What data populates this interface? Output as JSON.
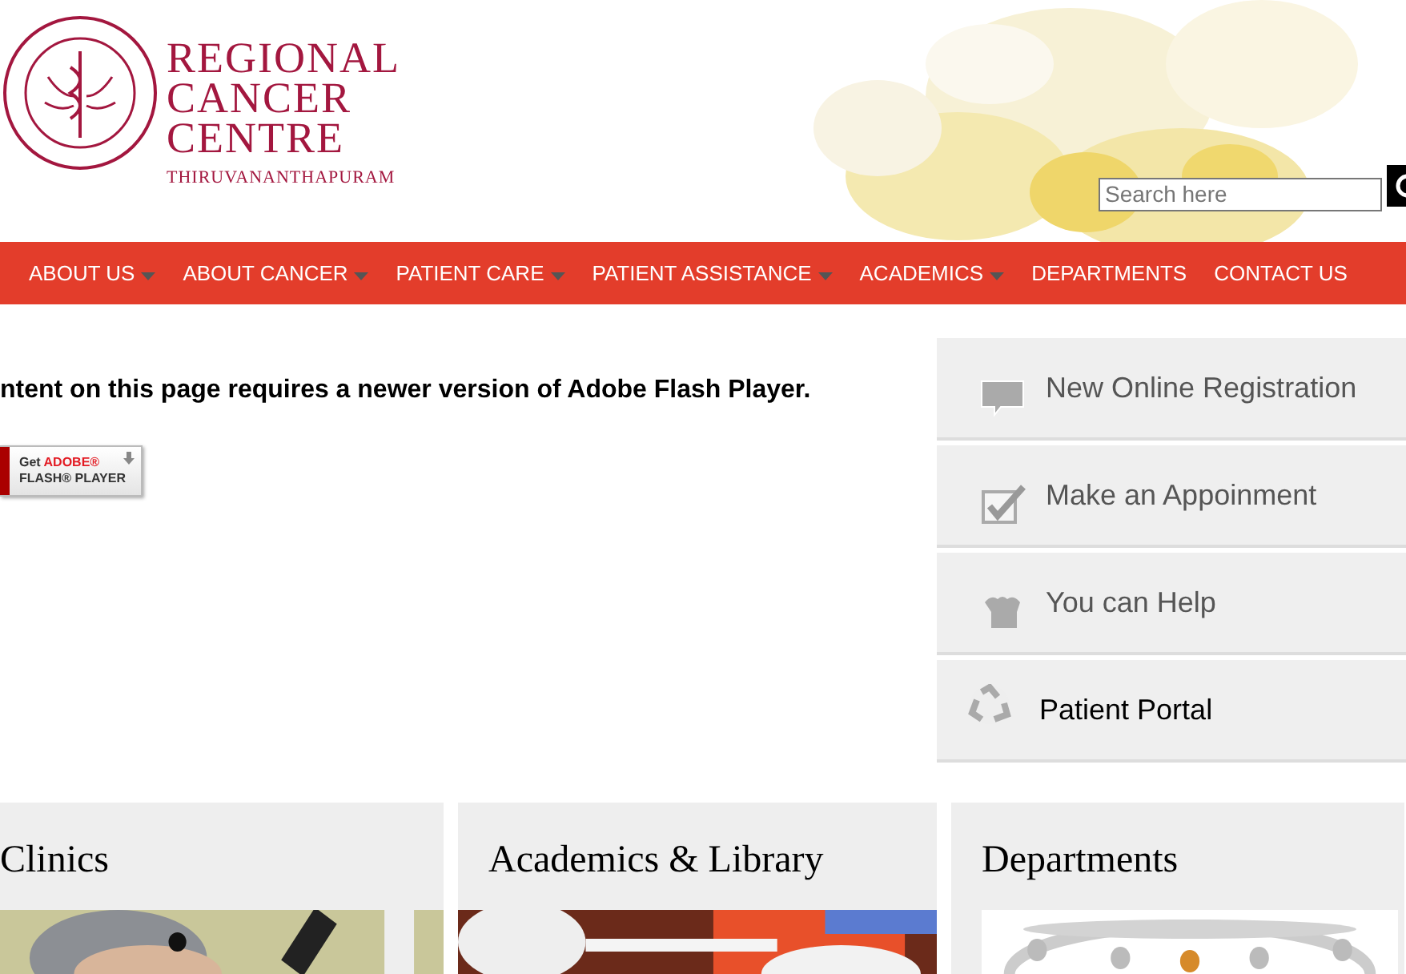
{
  "header": {
    "logo_lines": [
      "REGIONAL",
      "CANCER",
      "CENTRE"
    ],
    "logo_city": "THIRUVANANTHAPURAM",
    "search": {
      "placeholder": "Search here"
    }
  },
  "nav": [
    {
      "label": "ABOUT US",
      "has_menu": true
    },
    {
      "label": "ABOUT CANCER",
      "has_menu": true
    },
    {
      "label": "PATIENT CARE",
      "has_menu": true
    },
    {
      "label": "PATIENT ASSISTANCE",
      "has_menu": true
    },
    {
      "label": "ACADEMICS",
      "has_menu": true
    },
    {
      "label": "DEPARTMENTS",
      "has_menu": false
    },
    {
      "label": "CONTACT US",
      "has_menu": false
    }
  ],
  "flash_notice": {
    "message": "ntent on this page requires a newer version of Adobe Flash Player.",
    "badge_get": "Get",
    "badge_brand": "ADOBE®",
    "badge_product": "FLASH® PLAYER"
  },
  "quick_links": [
    {
      "kind": "chat",
      "label": "New Online Registration"
    },
    {
      "kind": "check",
      "label": "Make an Appoinment"
    },
    {
      "kind": "help",
      "label": "You can Help"
    },
    {
      "kind": "recycle",
      "label": "Patient Portal"
    }
  ],
  "cards": [
    {
      "title": "Clinics"
    },
    {
      "title": "Academics & Library"
    },
    {
      "title": "Departments"
    }
  ]
}
